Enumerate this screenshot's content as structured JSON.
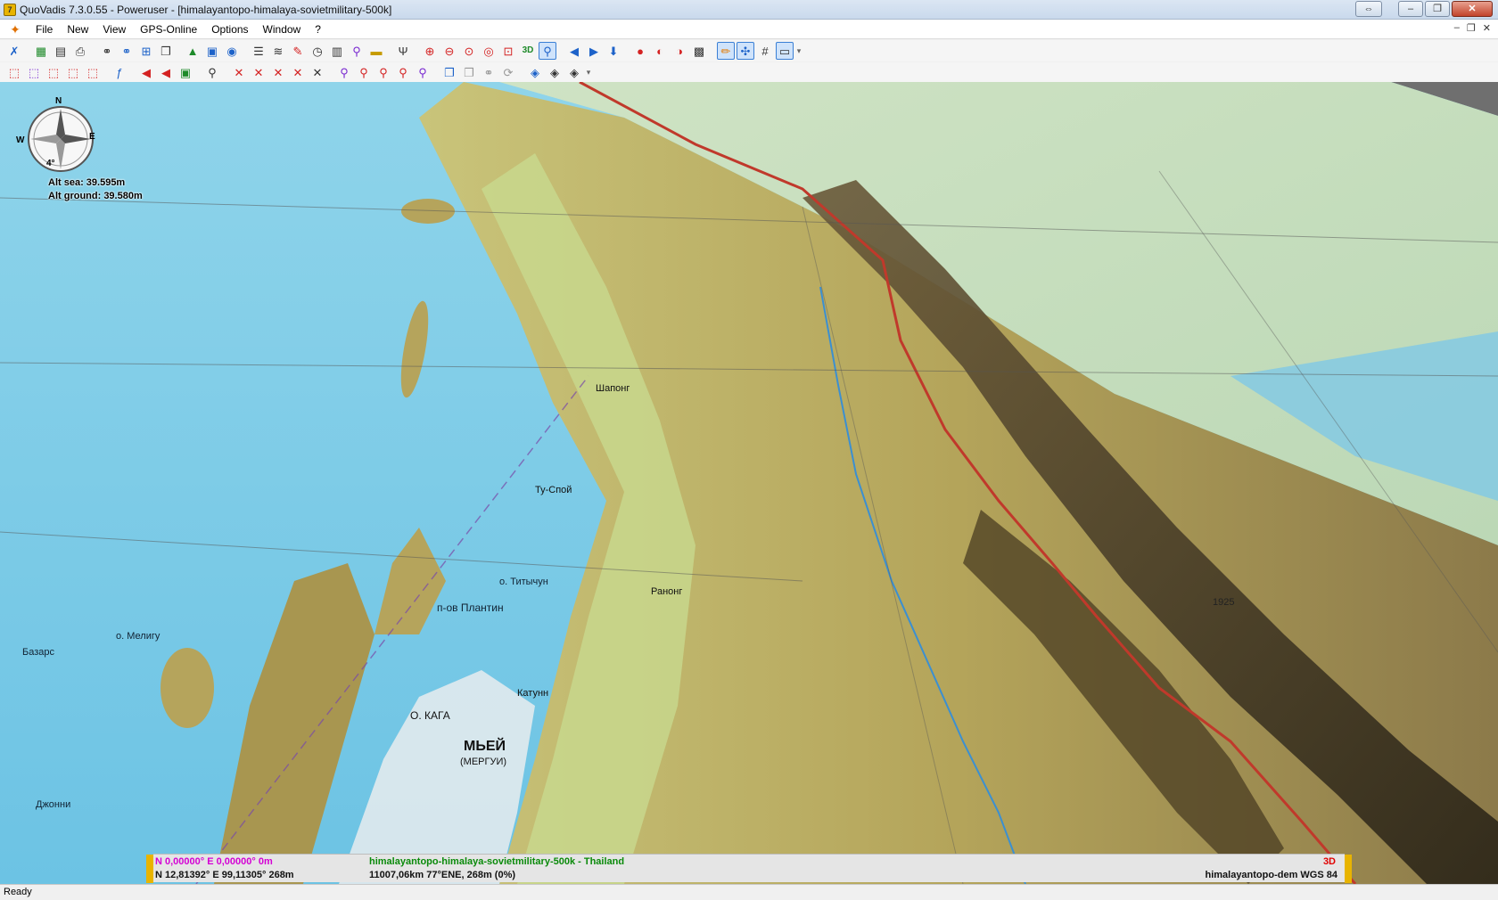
{
  "window": {
    "title": "QuoVadis 7.3.0.55 - Poweruser - [himalayantopo-himalaya-sovietmilitary-500k]",
    "app_icon": "7"
  },
  "menu": {
    "items": [
      "File",
      "New",
      "View",
      "GPS-Online",
      "Options",
      "Window",
      "?"
    ]
  },
  "toolbar1": [
    {
      "icon": "tools-icon",
      "glyph": "✗",
      "color": "c-blue"
    },
    {
      "icon": "map-icon",
      "glyph": "▦",
      "color": "c-green"
    },
    {
      "icon": "print-preview-icon",
      "glyph": "▤",
      "color": "c-dark"
    },
    {
      "icon": "print-icon",
      "glyph": "⎙",
      "color": "c-dark"
    },
    {
      "icon": "binoculars-icon",
      "glyph": "⚭",
      "color": "c-dark"
    },
    {
      "icon": "search-binoculars-icon",
      "glyph": "⚭",
      "color": "c-blue"
    },
    {
      "icon": "grid-icon",
      "glyph": "⊞",
      "color": "c-blue"
    },
    {
      "icon": "windows-icon",
      "glyph": "❐",
      "color": "c-dark"
    },
    {
      "icon": "terrain-icon",
      "glyph": "▲",
      "color": "c-green"
    },
    {
      "icon": "photo-icon",
      "glyph": "▣",
      "color": "c-blue"
    },
    {
      "icon": "globe-icon",
      "glyph": "◉",
      "color": "c-blue"
    },
    {
      "icon": "list-icon",
      "glyph": "☰",
      "color": "c-dark"
    },
    {
      "icon": "layers-icon",
      "glyph": "≋",
      "color": "c-dark"
    },
    {
      "icon": "route-edit-icon",
      "glyph": "✎",
      "color": "c-red"
    },
    {
      "icon": "clock-icon",
      "glyph": "◷",
      "color": "c-dark"
    },
    {
      "icon": "document-icon",
      "glyph": "▥",
      "color": "c-dark"
    },
    {
      "icon": "waypoint-icon",
      "glyph": "⚲",
      "color": "c-purple"
    },
    {
      "icon": "ruler-icon",
      "glyph": "▬",
      "color": "c-yellow"
    },
    {
      "icon": "tools-fork-icon",
      "glyph": "Ψ",
      "color": "c-dark"
    },
    {
      "icon": "zoom-in-icon",
      "glyph": "⊕",
      "color": "c-red"
    },
    {
      "icon": "zoom-out-icon",
      "glyph": "⊖",
      "color": "c-red"
    },
    {
      "icon": "zoom-fit-icon",
      "glyph": "⊙",
      "color": "c-red"
    },
    {
      "icon": "zoom-window-icon",
      "glyph": "◎",
      "color": "c-red"
    },
    {
      "icon": "zoom-area-icon",
      "glyph": "⊡",
      "color": "c-red"
    },
    {
      "icon": "view-3d-icon",
      "glyph": "3D",
      "color": "c-green"
    },
    {
      "icon": "zoom-select-icon",
      "glyph": "⚲",
      "color": "c-blue"
    },
    {
      "icon": "back-icon",
      "glyph": "◀",
      "color": "c-blue"
    },
    {
      "icon": "forward-icon",
      "glyph": "▶",
      "color": "c-blue"
    },
    {
      "icon": "download-icon",
      "glyph": "⬇",
      "color": "c-blue"
    },
    {
      "icon": "gps-record-icon",
      "glyph": "●",
      "color": "c-red"
    },
    {
      "icon": "gps-pause-icon",
      "glyph": "◐",
      "color": "c-red"
    },
    {
      "icon": "gps-stop-icon",
      "glyph": "◑",
      "color": "c-red"
    },
    {
      "icon": "gps-device-icon",
      "glyph": "▩",
      "color": "c-dark"
    },
    {
      "icon": "pencil-icon",
      "glyph": "✏",
      "color": "c-orange"
    },
    {
      "icon": "compass-icon",
      "glyph": "✣",
      "color": "c-blue"
    },
    {
      "icon": "map-grid-icon",
      "glyph": "#",
      "color": "c-dark"
    },
    {
      "icon": "display-icon",
      "glyph": "▭",
      "color": "c-dark"
    }
  ],
  "toolbar2": [
    {
      "icon": "waypoint-new-icon",
      "glyph": "⬚",
      "color": "c-red"
    },
    {
      "icon": "waypoint-list-icon",
      "glyph": "⬚",
      "color": "c-purple"
    },
    {
      "icon": "route-new-icon",
      "glyph": "⬚",
      "color": "c-red"
    },
    {
      "icon": "route-list-icon",
      "glyph": "⬚",
      "color": "c-red"
    },
    {
      "icon": "track-new-icon",
      "glyph": "⬚",
      "color": "c-red"
    },
    {
      "icon": "script-icon",
      "glyph": "ƒ",
      "color": "c-blue"
    },
    {
      "icon": "rewind-icon",
      "glyph": "◀",
      "color": "c-red"
    },
    {
      "icon": "replay-icon",
      "glyph": "◀",
      "color": "c-red"
    },
    {
      "icon": "color-palette-icon",
      "glyph": "▣",
      "color": "c-green"
    },
    {
      "icon": "search-map-icon",
      "glyph": "⚲",
      "color": "c-dark"
    },
    {
      "icon": "remove-point-icon",
      "glyph": "✕",
      "color": "c-red"
    },
    {
      "icon": "remove-route-icon",
      "glyph": "✕",
      "color": "c-red"
    },
    {
      "icon": "remove-track-icon",
      "glyph": "✕",
      "color": "c-red"
    },
    {
      "icon": "remove-area-icon",
      "glyph": "✕",
      "color": "c-red"
    },
    {
      "icon": "remove-all-icon",
      "glyph": "✕",
      "color": "c-dark"
    },
    {
      "icon": "find-point-icon",
      "glyph": "⚲",
      "color": "c-purple"
    },
    {
      "icon": "find-route-icon",
      "glyph": "⚲",
      "color": "c-red"
    },
    {
      "icon": "find-track-icon",
      "glyph": "⚲",
      "color": "c-red"
    },
    {
      "icon": "find-area-icon",
      "glyph": "⚲",
      "color": "c-red"
    },
    {
      "icon": "find-all-icon",
      "glyph": "⚲",
      "color": "c-purple"
    },
    {
      "icon": "copy-layer-icon",
      "glyph": "❐",
      "color": "c-blue"
    },
    {
      "icon": "disabled-copy-icon",
      "glyph": "❐",
      "color": "c-grey"
    },
    {
      "icon": "disabled-link-icon",
      "glyph": "⚭",
      "color": "c-grey"
    },
    {
      "icon": "disabled-sync-icon",
      "glyph": "⟳",
      "color": "c-grey"
    },
    {
      "icon": "database-icon",
      "glyph": "◈",
      "color": "c-blue"
    },
    {
      "icon": "database-search-icon",
      "glyph": "◈",
      "color": "c-dark"
    },
    {
      "icon": "database-export-icon",
      "glyph": "◈",
      "color": "c-dark"
    }
  ],
  "compass": {
    "n": "N",
    "e": "E",
    "w": "W",
    "tilt": "4°"
  },
  "altitude": {
    "sea": "Alt sea: 39.595m",
    "ground": "Alt ground: 39.580m"
  },
  "status_overlay": {
    "cursor_coords": "N 0,00000°  E 0,00000°  0m",
    "position": "N 12,81392°  E 99,11305°  268m",
    "map_name": "himalayantopo-himalaya-sovietmilitary-500k - Thailand",
    "distance": "11007,06km 77°ENE,  268m (0%)",
    "mode": "3D",
    "dem_info": "himalayantopo-dem  WGS 84"
  },
  "statusbar": {
    "text": "Ready"
  },
  "map_labels": {
    "sea_label_1": "о. Мелигу",
    "sea_label_2": "Базарс",
    "sea_label_3": "п-ов Плантин",
    "sea_label_4": "о. Титычун",
    "city_label": "МЬЕЙ",
    "city_label_sub": "(МЕРГУИ)",
    "town_label_1": "Катунн",
    "town_label_2": "О. КАГА",
    "town_label_3": "Шапонг",
    "town_label_4": "Ту-Спой",
    "town_label_5": "Джонни",
    "town_label_6": "Ранонг",
    "elev_label": "1925"
  }
}
